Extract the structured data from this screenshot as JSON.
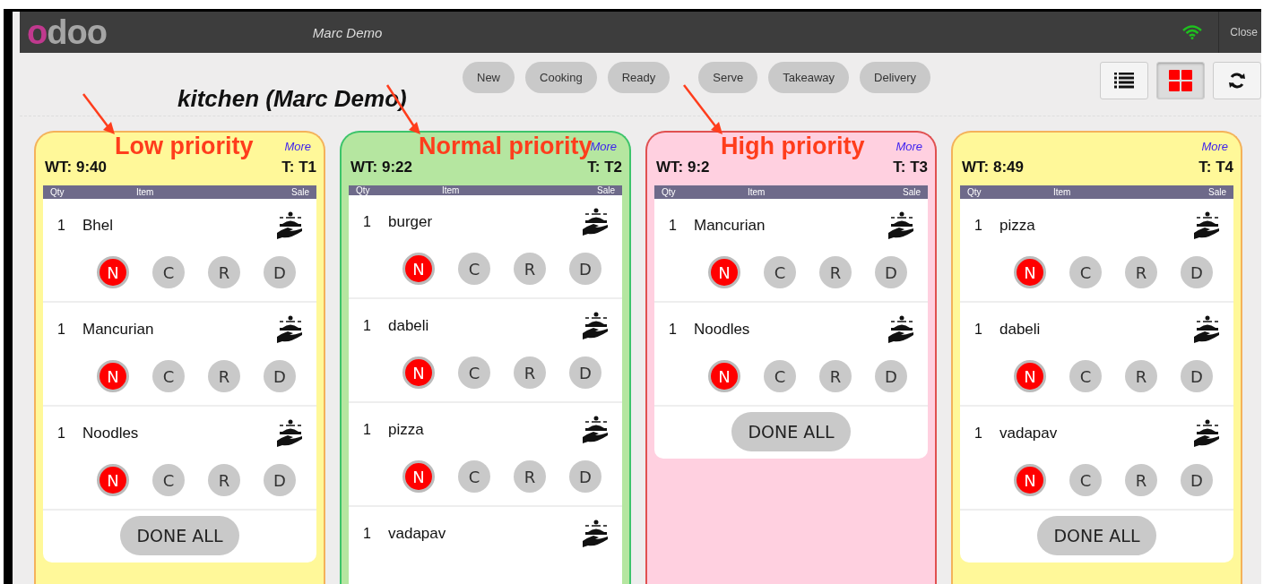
{
  "topbar": {
    "logo": "odoo",
    "user": "Marc Demo",
    "close": "Close"
  },
  "filters": [
    "New",
    "Cooking",
    "Ready",
    "Serve",
    "Takeaway",
    "Delivery"
  ],
  "view_buttons": [
    {
      "kind": "list",
      "selected": false
    },
    {
      "kind": "grid",
      "selected": true
    },
    {
      "kind": "refresh",
      "selected": false
    }
  ],
  "title": "kitchen (Marc Demo)",
  "cards": [
    {
      "kind": "low",
      "more": "More",
      "columns": [
        "Qty",
        "Item",
        "Sale"
      ],
      "wait": "WT: 9:40",
      "table": "T: T1",
      "annotation": "Low priority",
      "done": "DONE ALL",
      "items": [
        {
          "qty": "1",
          "name": "Bhel",
          "statuses": [
            {
              "label": "N",
              "selected": true
            },
            {
              "label": "C",
              "selected": false
            },
            {
              "label": "R",
              "selected": false
            },
            {
              "label": "D",
              "selected": false
            }
          ]
        },
        {
          "qty": "1",
          "name": "Mancurian",
          "statuses": [
            {
              "label": "N",
              "selected": true
            },
            {
              "label": "C",
              "selected": false
            },
            {
              "label": "R",
              "selected": false
            },
            {
              "label": "D",
              "selected": false
            }
          ]
        },
        {
          "qty": "1",
          "name": "Noodles",
          "statuses": [
            {
              "label": "N",
              "selected": true
            },
            {
              "label": "C",
              "selected": false
            },
            {
              "label": "R",
              "selected": false
            },
            {
              "label": "D",
              "selected": false
            }
          ]
        }
      ]
    },
    {
      "kind": "normal",
      "more": "More",
      "columns": [
        "Qty",
        "Item",
        "Sale"
      ],
      "wait": "WT: 9:22",
      "table": "T: T2",
      "annotation": "Normal priority",
      "items": [
        {
          "qty": "1",
          "name": "burger",
          "statuses": [
            {
              "label": "N",
              "selected": true
            },
            {
              "label": "C",
              "selected": false
            },
            {
              "label": "R",
              "selected": false
            },
            {
              "label": "D",
              "selected": false
            }
          ]
        },
        {
          "qty": "1",
          "name": "dabeli",
          "statuses": [
            {
              "label": "N",
              "selected": true
            },
            {
              "label": "C",
              "selected": false
            },
            {
              "label": "R",
              "selected": false
            },
            {
              "label": "D",
              "selected": false
            }
          ]
        },
        {
          "qty": "1",
          "name": "pizza",
          "statuses": [
            {
              "label": "N",
              "selected": true
            },
            {
              "label": "C",
              "selected": false
            },
            {
              "label": "R",
              "selected": false
            },
            {
              "label": "D",
              "selected": false
            }
          ]
        },
        {
          "qty": "1",
          "name": "vadapav"
        }
      ]
    },
    {
      "kind": "high",
      "more": "More",
      "columns": [
        "Qty",
        "Item",
        "Sale"
      ],
      "wait": "WT: 9:2",
      "table": "T: T3",
      "annotation": "High priority",
      "done": "DONE ALL",
      "items": [
        {
          "qty": "1",
          "name": "Mancurian",
          "statuses": [
            {
              "label": "N",
              "selected": true
            },
            {
              "label": "C",
              "selected": false
            },
            {
              "label": "R",
              "selected": false
            },
            {
              "label": "D",
              "selected": false
            }
          ]
        },
        {
          "qty": "1",
          "name": "Noodles",
          "statuses": [
            {
              "label": "N",
              "selected": true
            },
            {
              "label": "C",
              "selected": false
            },
            {
              "label": "R",
              "selected": false
            },
            {
              "label": "D",
              "selected": false
            }
          ]
        }
      ]
    },
    {
      "kind": "low",
      "more": "More",
      "columns": [
        "Qty",
        "Item",
        "Sale"
      ],
      "wait": "WT: 8:49",
      "table": "T: T4",
      "done": "DONE ALL",
      "items": [
        {
          "qty": "1",
          "name": "pizza",
          "statuses": [
            {
              "label": "N",
              "selected": true
            },
            {
              "label": "C",
              "selected": false
            },
            {
              "label": "R",
              "selected": false
            },
            {
              "label": "D",
              "selected": false
            }
          ]
        },
        {
          "qty": "1",
          "name": "dabeli",
          "statuses": [
            {
              "label": "N",
              "selected": true
            },
            {
              "label": "C",
              "selected": false
            },
            {
              "label": "R",
              "selected": false
            },
            {
              "label": "D",
              "selected": false
            }
          ]
        },
        {
          "qty": "1",
          "name": "vadapav",
          "statuses": [
            {
              "label": "N",
              "selected": true
            },
            {
              "label": "C",
              "selected": false
            },
            {
              "label": "R",
              "selected": false
            },
            {
              "label": "D",
              "selected": false
            }
          ]
        }
      ]
    }
  ]
}
